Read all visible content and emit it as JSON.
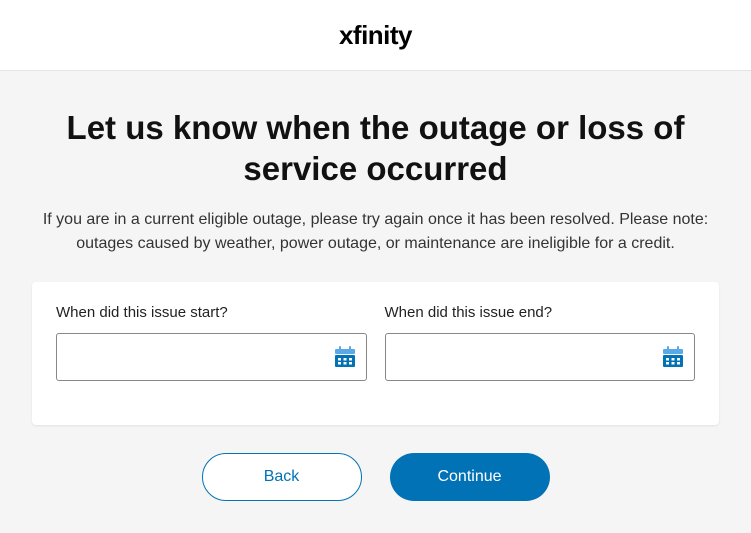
{
  "header": {
    "brand": "xfinity"
  },
  "page": {
    "title": "Let us know when the outage or loss of service occurred",
    "description": "If you are in a current eligible outage, please try again once it has been resolved. Please note: outages caused by weather, power outage, or maintenance are ineligible for a credit."
  },
  "form": {
    "start_label": "When did this issue start?",
    "start_value": "",
    "end_label": "When did this issue end?",
    "end_value": ""
  },
  "buttons": {
    "back": "Back",
    "continue": "Continue"
  },
  "colors": {
    "primary": "#0272b6",
    "icon_light": "#5aa9e6",
    "icon_dark": "#0272b6"
  }
}
